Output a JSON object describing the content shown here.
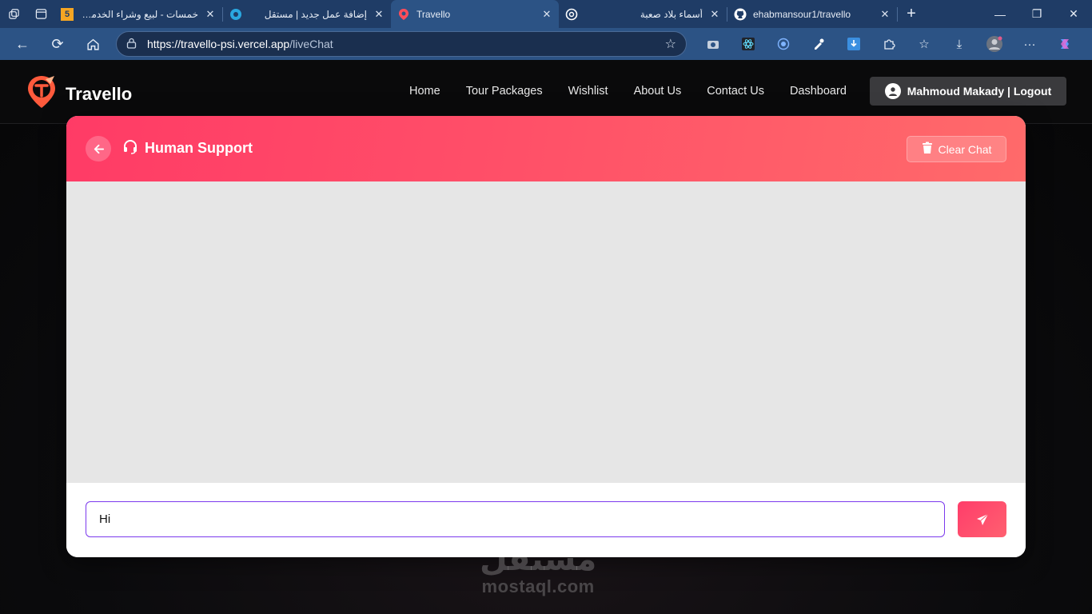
{
  "browser": {
    "tabs": [
      {
        "title": "خمسات - لبيع وشراء الخدمات",
        "rtl": true,
        "favicon_text": "5",
        "favicon_color": "#f5a623",
        "active": false
      },
      {
        "title": "إضافة عمل جديد | مستقل",
        "rtl": true,
        "favicon_color": "#2aa8e0",
        "active": false
      },
      {
        "title": "Travello",
        "rtl": false,
        "favicon_color": "#ff4d5a",
        "active": true
      },
      {
        "title": "أسماء بلاد صعبة",
        "rtl": true,
        "favicon_color": "#ffffff",
        "active": false
      },
      {
        "title": "ehabmansour1/travello",
        "rtl": false,
        "favicon_color": "#ffffff",
        "active": false
      }
    ],
    "url_host": "https://travello-psi.vercel.app",
    "url_path": "/liveChat"
  },
  "site": {
    "brand": "Travello",
    "nav": [
      "Home",
      "Tour Packages",
      "Wishlist",
      "About Us",
      "Contact Us",
      "Dashboard"
    ],
    "user_button": "Mahmoud Makady | Logout"
  },
  "chat": {
    "title": "Human Support",
    "clear_label": "Clear Chat",
    "input_value": "Hi"
  },
  "watermark": {
    "arabic": "مستقل",
    "latin": "mostaql.com"
  },
  "colors": {
    "accent": "#ff4466",
    "input_border": "#7c3aed",
    "tabbar": "#1f3c66"
  }
}
